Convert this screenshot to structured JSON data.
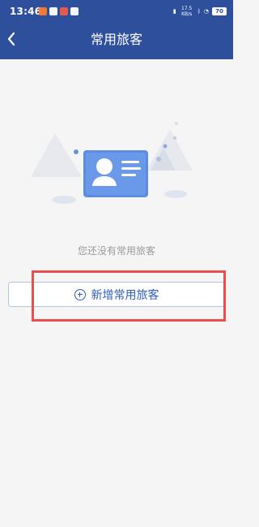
{
  "status_bar": {
    "time": "13:46",
    "network_speed_value": "17.5",
    "network_speed_unit": "KB/s",
    "battery": "70"
  },
  "header": {
    "title": "常用旅客"
  },
  "empty_state": {
    "message": "您还没有常用旅客"
  },
  "actions": {
    "add_traveler_label": "新增常用旅客"
  },
  "colors": {
    "header_bg": "#2d4f9c",
    "accent": "#2d5db8",
    "highlight": "#e94f4f"
  }
}
